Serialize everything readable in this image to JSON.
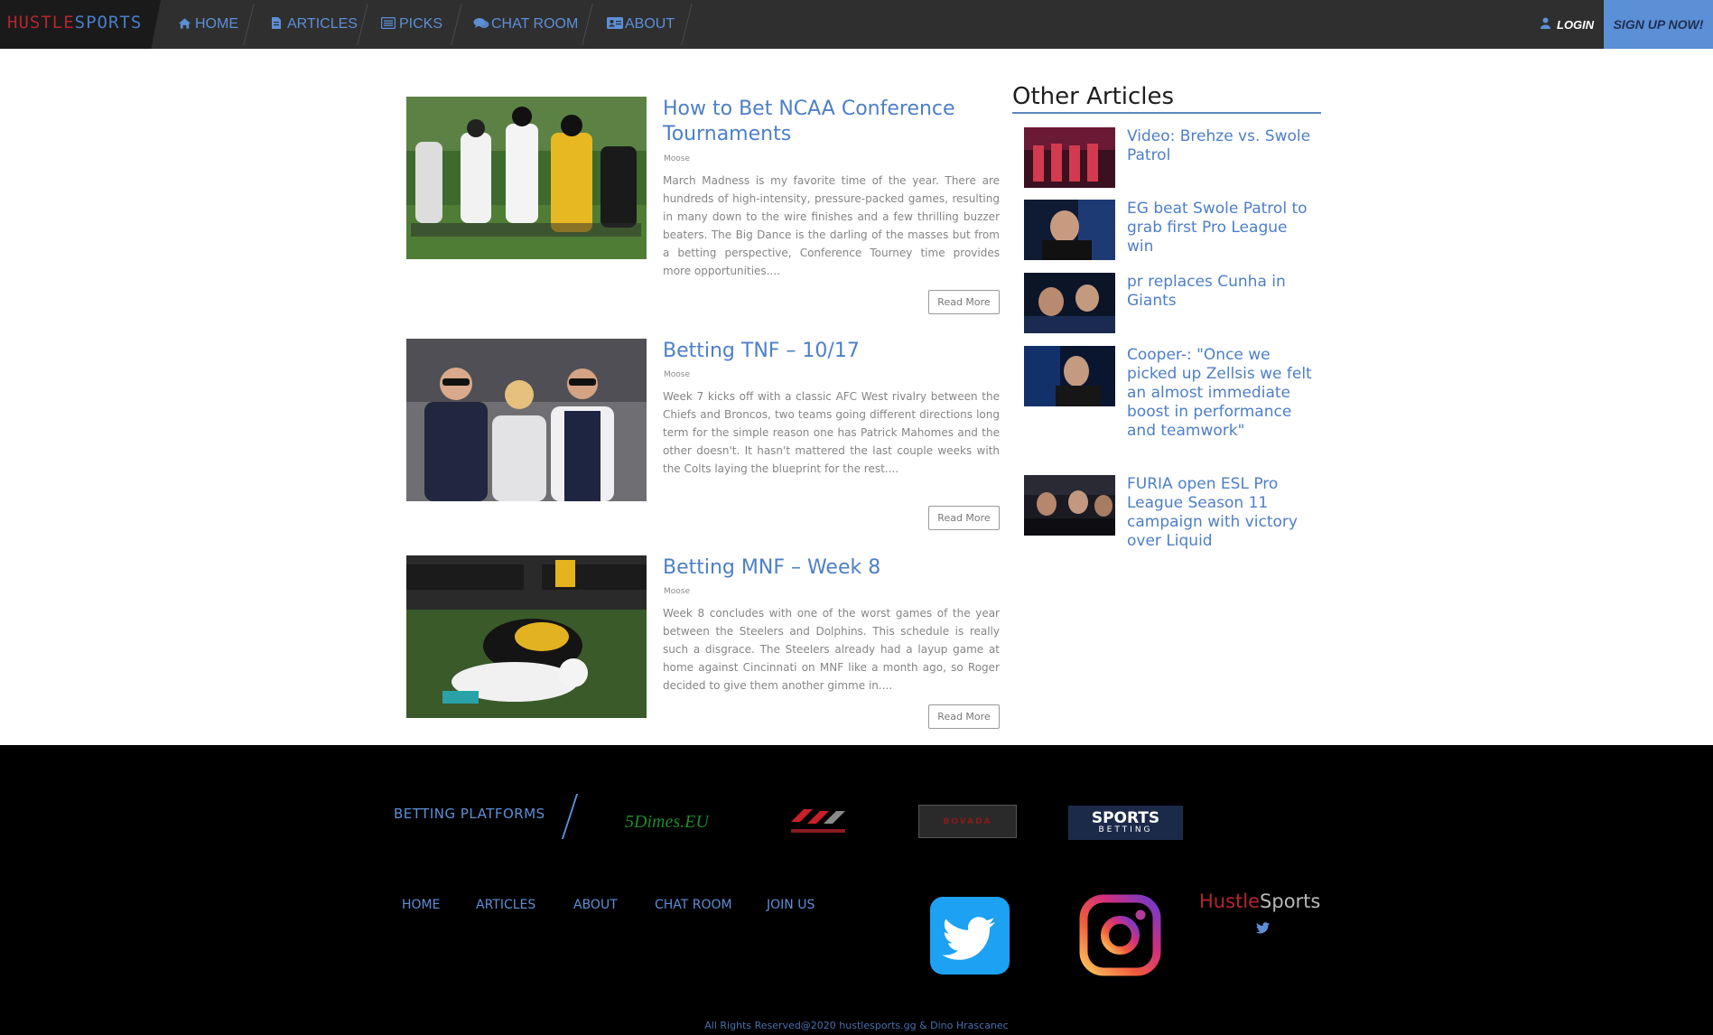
{
  "nav": {
    "logo_part1": "HUSTLE",
    "logo_part2": "SPORTS",
    "items": [
      {
        "label": "HOME",
        "icon": "home-icon"
      },
      {
        "label": "ARTICLES",
        "icon": "document-icon"
      },
      {
        "label": "PICKS",
        "icon": "list-icon"
      },
      {
        "label": "CHAT ROOM",
        "icon": "chat-icon"
      },
      {
        "label": "ABOUT",
        "icon": "id-card-icon"
      }
    ],
    "login": "LOGIN",
    "signup": "SIGN UP NOW!"
  },
  "articles": [
    {
      "title": "How to Bet NCAA Conference Tournaments",
      "author": "Moose",
      "body": "March Madness is my favorite time of the year. There are hundreds of high-intensity, pressure-packed games, resulting in many down to the wire finishes and a few thrilling buzzer beaters. The Big Dance is the darling of the masses but from a betting perspective, Conference Tourney time provides more opportunities....",
      "read_more": "Read More"
    },
    {
      "title": "Betting TNF – 10/17",
      "author": "Moose",
      "body": "Week 7 kicks off with a classic AFC West rivalry between the Chiefs and Broncos, two teams going different directions long term for the simple reason one has Patrick Mahomes and the other doesn't. It hasn't mattered the last couple weeks with the Colts laying the blueprint for the rest....",
      "read_more": "Read More"
    },
    {
      "title": "Betting MNF – Week 8",
      "author": "Moose",
      "body": "Week 8 concludes with one of the worst games of the year between the Steelers and Dolphins. This schedule is really such a disgrace. The Steelers already had a layup game at home against Cincinnati on MNF like a month ago, so Roger decided to give them another gimme in....",
      "read_more": "Read More"
    }
  ],
  "sidebar": {
    "title": "Other Articles",
    "items": [
      {
        "title": "Video: Brehze vs. Swole Patrol"
      },
      {
        "title": "EG beat Swole Patrol to grab first Pro League win"
      },
      {
        "title": "pr replaces Cunha in Giants"
      },
      {
        "title": "Cooper-: \"Once we picked up Zellsis we felt an almost immediate boost in performance and teamwork\""
      },
      {
        "title": "FURIA open ESL Pro League Season 11 campaign with victory over Liquid"
      }
    ]
  },
  "footer": {
    "betting_label": "BETTING PLATFORMS",
    "platforms": {
      "fivedimes": "5Dimes.EU",
      "bovada": "BOVADA",
      "sports_line1": "SPORTS",
      "sports_line2": "BETTING"
    },
    "links": [
      "HOME",
      "ARTICLES",
      "ABOUT",
      "CHAT ROOM",
      "JOIN US"
    ],
    "brand_part1": "Hustle",
    "brand_part2": "Sports",
    "copyright": "All Rights Reserved@2020 hustlesports.gg & Dino Hrascanec"
  },
  "colors": {
    "accent": "#5b8fd6",
    "link": "#4d7fc6",
    "nav_bg": "#2f2f2f",
    "brand_red": "#b3262e"
  }
}
